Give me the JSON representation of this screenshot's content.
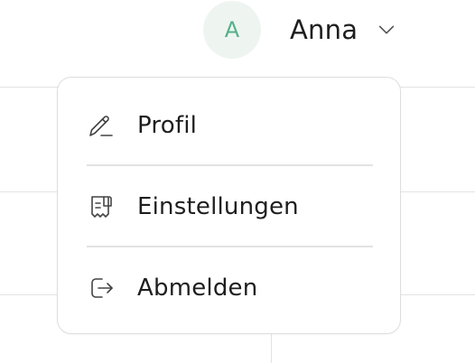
{
  "user": {
    "avatar_initial": "A",
    "name": "Anna",
    "avatar_bg": "#eef5f1",
    "avatar_text_color": "#55b08a",
    "dropdown_icon": "chevron-down-icon"
  },
  "menu": {
    "items": [
      {
        "label": "Profil",
        "icon": "pencil-edit-icon"
      },
      {
        "label": "Einstellungen",
        "icon": "settings-receipt-icon"
      },
      {
        "label": "Abmelden",
        "icon": "logout-icon"
      }
    ]
  }
}
